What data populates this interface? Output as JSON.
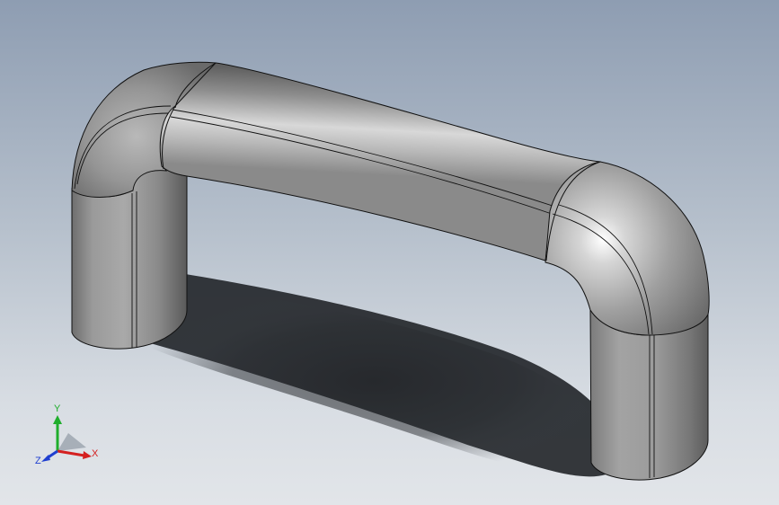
{
  "viewport": {
    "background_top": "#8e9db2",
    "background_bottom": "#e2e5e9",
    "model": "u-shaped-handle"
  },
  "triad": {
    "x_label": "X",
    "y_label": "Y",
    "z_label": "Z",
    "x_color": "#d42020",
    "y_color": "#1fae2c",
    "z_color": "#1f3fd0"
  }
}
